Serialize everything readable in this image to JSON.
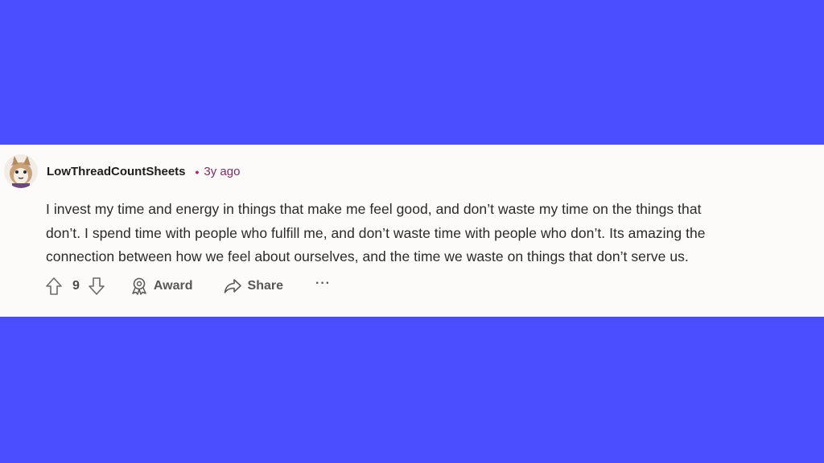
{
  "comment": {
    "author": "LowThreadCountSheets",
    "separator": "•",
    "timestamp": "3y ago",
    "body_lines": [
      "I invest my time and energy in things that make me feel good, and don’t waste my time on the things that",
      "don’t. I spend time with people who fulfill me, and don’t waste time with people who don’t. Its amazing the",
      "connection between how we feel about ourselves, and the time we waste on things that don’t serve us."
    ],
    "vote_count": "9",
    "actions": {
      "award_label": "Award",
      "share_label": "Share",
      "more_label": "···"
    }
  },
  "icons": {
    "upvote": "upvote-arrow-icon",
    "downvote": "downvote-arrow-icon",
    "award": "award-ribbon-icon",
    "share": "share-arrow-icon",
    "more": "more-dots-icon"
  },
  "colors": {
    "background": "#4a4eff",
    "card": "#fdfbfa",
    "timestamp": "#7a2e62",
    "text": "#2a2a2a"
  }
}
